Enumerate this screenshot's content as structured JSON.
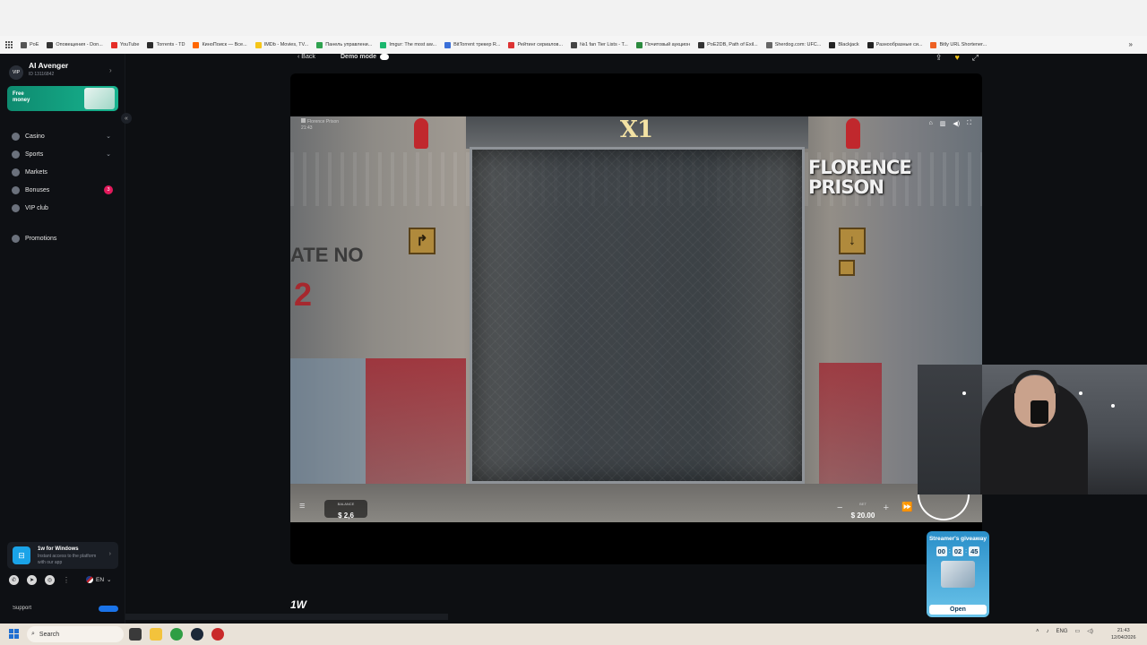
{
  "bookmarks": [
    {
      "label": "PoE",
      "color": "#555555"
    },
    {
      "label": "Оповещения - Don...",
      "color": "#333333"
    },
    {
      "label": "YouTube",
      "color": "#e52d27"
    },
    {
      "label": "Torrents - TD",
      "color": "#2b2b2b"
    },
    {
      "label": "КиноПоиск — Все...",
      "color": "#f60"
    },
    {
      "label": "IMDb - Movies, TV...",
      "color": "#f5c518"
    },
    {
      "label": "Панель управлени...",
      "color": "#2fa24f"
    },
    {
      "label": "Imgur: The most aw...",
      "color": "#1bb76e"
    },
    {
      "label": "BitTorrent трекер R...",
      "color": "#3a6fd8"
    },
    {
      "label": "Рейтинг сериалов...",
      "color": "#d33"
    },
    {
      "label": "№1 fan Tier Lists - T...",
      "color": "#444444"
    },
    {
      "label": "Почитовый аукцион",
      "color": "#2b8a3e"
    },
    {
      "label": "PoE2DB, Path of Exil...",
      "color": "#333333"
    },
    {
      "label": "Sherdog.com: UFC...",
      "color": "#666666"
    },
    {
      "label": "Blackjack",
      "color": "#222222"
    },
    {
      "label": "Разнообразные си...",
      "color": "#222222"
    },
    {
      "label": "Bitly URL Shortener...",
      "color": "#ee6123"
    }
  ],
  "user": {
    "badge": "VIP",
    "name": "AI Avenger",
    "id": "ID 13116842"
  },
  "promo": {
    "label": "Free money"
  },
  "nav": [
    {
      "label": "Casino",
      "chevron": true
    },
    {
      "label": "Sports",
      "chevron": true
    },
    {
      "label": "Markets"
    },
    {
      "label": "Bonuses",
      "badge": "3"
    },
    {
      "label": "VIP club"
    }
  ],
  "promotions": {
    "label": "Promotions"
  },
  "app_card": {
    "title": "1w for Windows",
    "subtitle": "Instant access to the platform with our app"
  },
  "language": "EN",
  "support": "Support",
  "topbar": {
    "back": "Back",
    "demo": "Demo mode"
  },
  "game": {
    "multiplier": "X1",
    "title_line1": "FLORENCE",
    "title_line2": "PRISON",
    "subtitle": "Florence Prison",
    "time": "21:43",
    "gate_text": "ATE NO",
    "gate_number": "2",
    "balance_label": "BALANCE",
    "balance_value": "$ 2,6",
    "bet_label": "BET",
    "bet_value": "$ 20.00"
  },
  "brand": "1W",
  "giveaway": {
    "title": "Streamer's giveaway",
    "hours": "00",
    "minutes": "02",
    "seconds": "45",
    "open": "Open"
  },
  "taskbar": {
    "search": "Search",
    "lang": "ENG",
    "time": "21:43",
    "date": "12/04/2026"
  },
  "colors": {
    "accent_green": "#17b48f",
    "badge_pink": "#e2195b",
    "giveaway_blue": "#2a8fc9"
  }
}
